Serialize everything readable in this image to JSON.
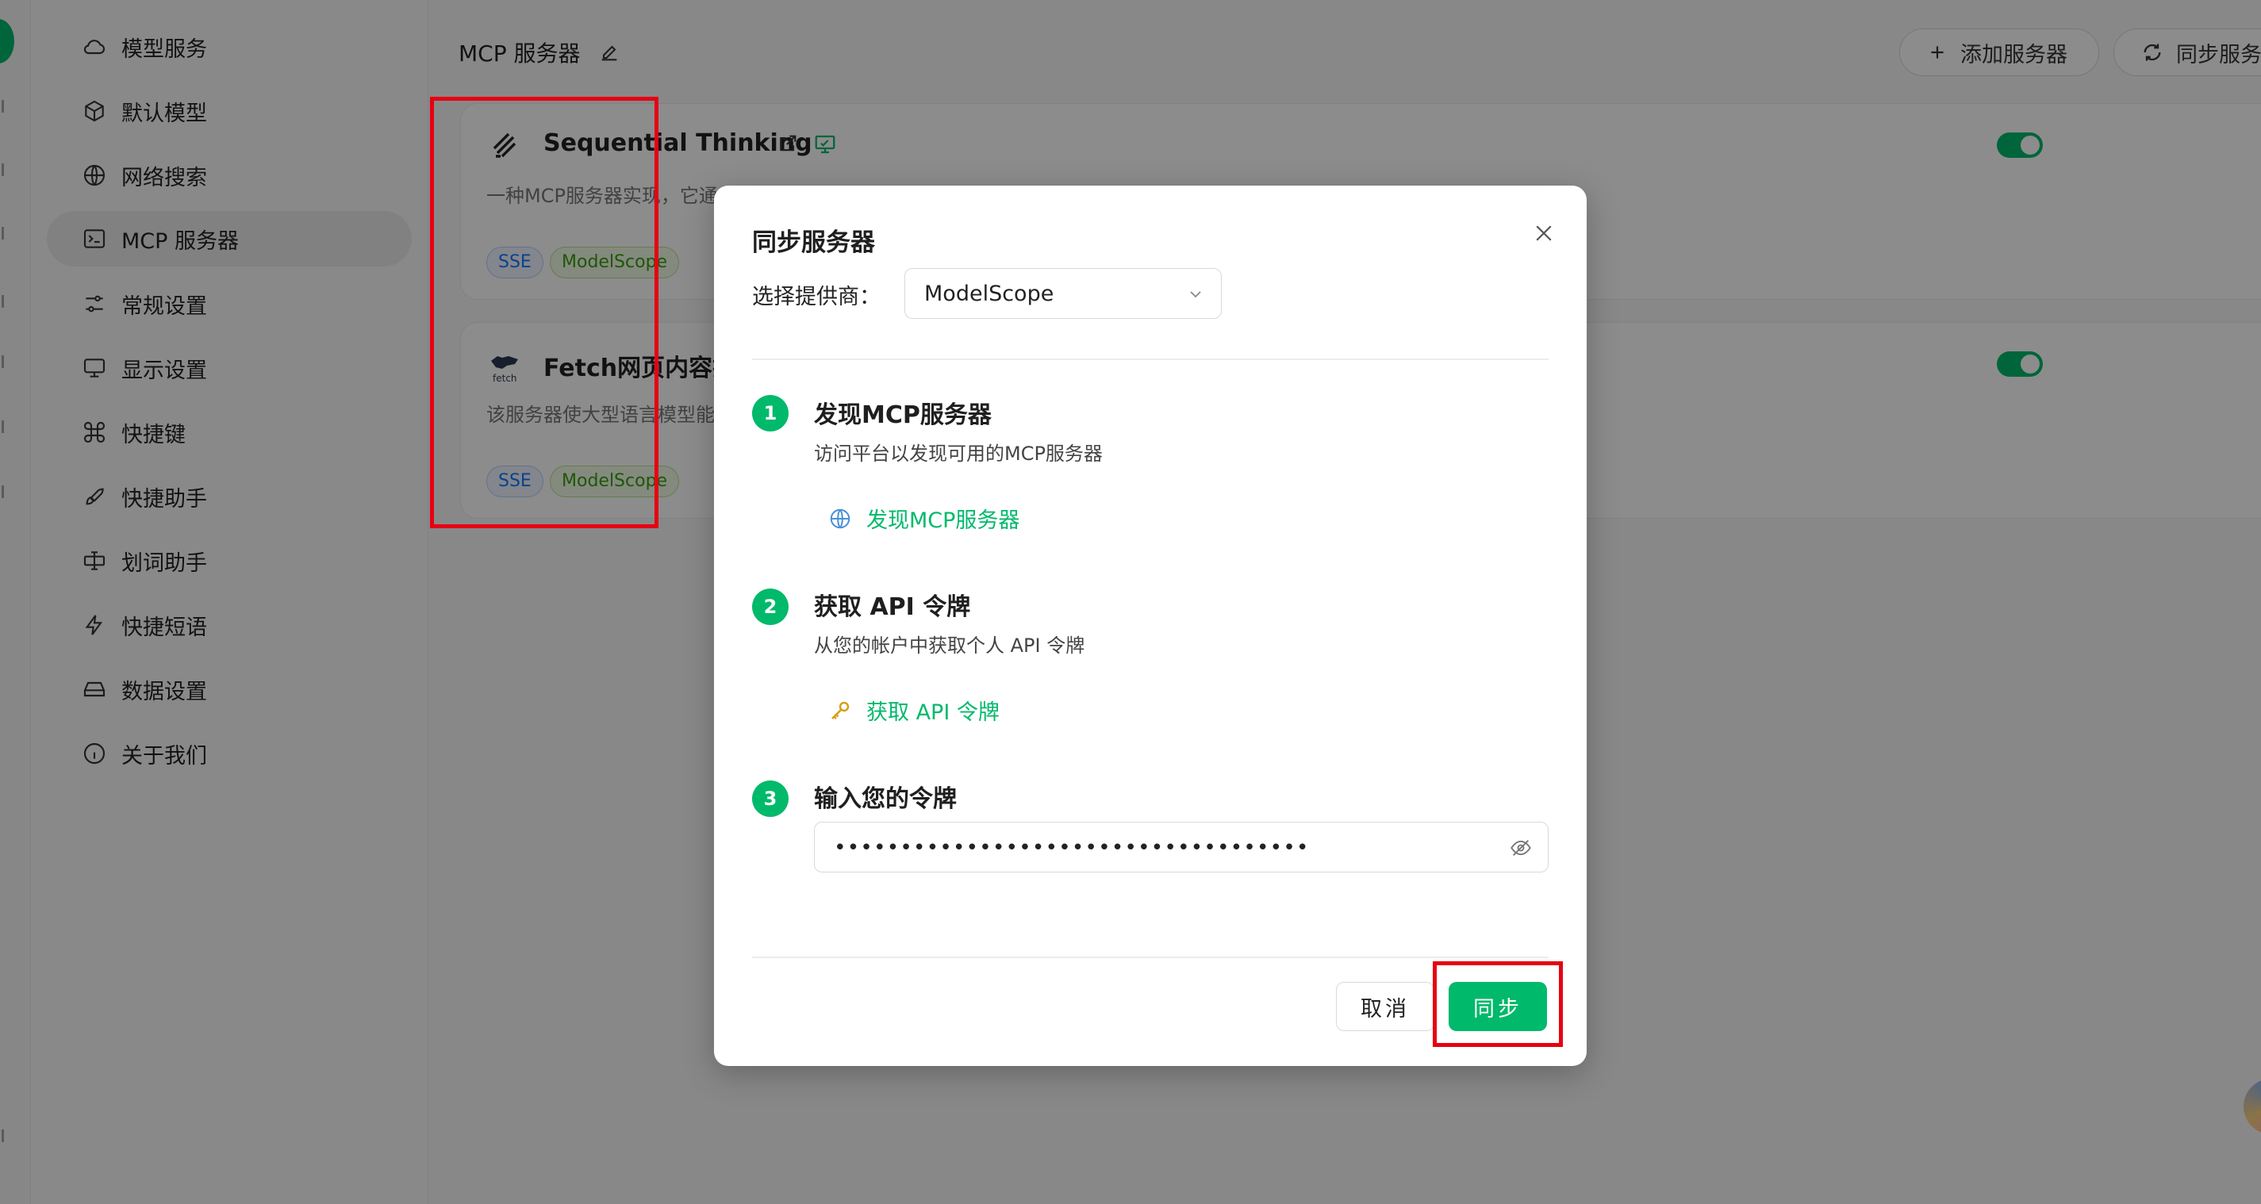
{
  "sidebar": {
    "items": [
      {
        "label": "模型服务",
        "icon": "cloud-icon"
      },
      {
        "label": "默认模型",
        "icon": "cube-icon"
      },
      {
        "label": "网络搜索",
        "icon": "globe-icon"
      },
      {
        "label": "MCP 服务器",
        "icon": "terminal-icon",
        "active": true
      },
      {
        "label": "常规设置",
        "icon": "settings-sliders-icon"
      },
      {
        "label": "显示设置",
        "icon": "monitor-icon"
      },
      {
        "label": "快捷键",
        "icon": "command-icon"
      },
      {
        "label": "快捷助手",
        "icon": "rocket-icon"
      },
      {
        "label": "划词助手",
        "icon": "text-select-icon"
      },
      {
        "label": "快捷短语",
        "icon": "zap-icon"
      },
      {
        "label": "数据设置",
        "icon": "hard-drive-icon"
      },
      {
        "label": "关于我们",
        "icon": "info-icon"
      }
    ]
  },
  "header": {
    "title": "MCP 服务器",
    "add_label": "添加服务器",
    "sync_label": "同步服务"
  },
  "servers": [
    {
      "name": "Sequential Thinking",
      "desc": "一种MCP服务器实现，它通",
      "tags": [
        "SSE",
        "ModelScope"
      ]
    },
    {
      "name": "Fetch网页内容抓",
      "desc": "该服务器使大型语言模型能",
      "tags": [
        "SSE",
        "ModelScope"
      ]
    }
  ],
  "modal": {
    "title": "同步服务器",
    "provider_label": "选择提供商：",
    "provider_value": "ModelScope",
    "steps": [
      {
        "num": "1",
        "title": "发现MCP服务器",
        "desc": "访问平台以发现可用的MCP服务器",
        "link": "发现MCP服务器"
      },
      {
        "num": "2",
        "title": "获取 API 令牌",
        "desc": "从您的帐户中获取个人 API 令牌",
        "link": "获取 API 令牌"
      },
      {
        "num": "3",
        "title": "输入您的令牌"
      }
    ],
    "token_value": "••••••••••••••••••••••••••••••••••••",
    "cancel_label": "取消",
    "confirm_label": "同步"
  },
  "colors": {
    "accent": "#00b96b",
    "annotation": "#e60012",
    "overlay": "rgba(0,0,0,0.45)"
  }
}
